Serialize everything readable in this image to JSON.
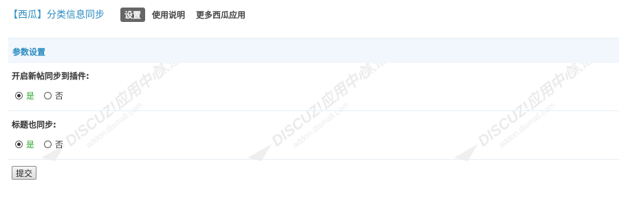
{
  "header": {
    "app_title": "【西瓜】分类信息同步",
    "tabs": [
      {
        "label": "设置",
        "active": true
      },
      {
        "label": "使用说明",
        "active": false
      },
      {
        "label": "更多西瓜应用",
        "active": false
      }
    ]
  },
  "section": {
    "title": "参数设置"
  },
  "settings": [
    {
      "label": "开启新帖同步到插件:",
      "options": [
        {
          "label": "是",
          "checked": true
        },
        {
          "label": "否",
          "checked": false
        }
      ]
    },
    {
      "label": "标题也同步:",
      "options": [
        {
          "label": "是",
          "checked": true
        },
        {
          "label": "否",
          "checked": false
        }
      ]
    }
  ],
  "submit_label": "提交",
  "watermark": {
    "brand": "DISCUZ!应用中心",
    "domain": "addon.dismall.com",
    "mark": "贰道"
  },
  "colors": {
    "title_blue": "#2a8bc0",
    "active_tab_bg": "#666666",
    "section_bg": "#f1f7fc",
    "yes_green": "#2aa52a"
  }
}
